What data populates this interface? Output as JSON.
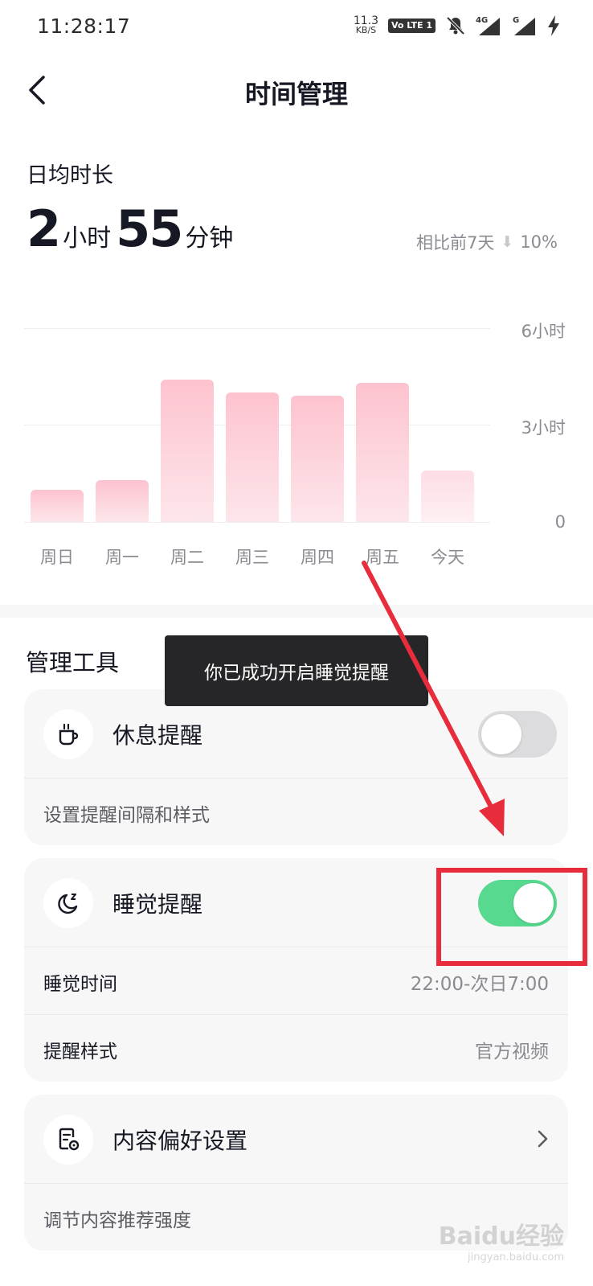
{
  "status_bar": {
    "time": "11:28:17",
    "net_speed_value": "11.3",
    "net_speed_unit": "KB/S",
    "volte": "Vo LTE 1",
    "signal_4g": "4G",
    "signal_g": "G"
  },
  "nav": {
    "title": "时间管理"
  },
  "summary": {
    "label": "日均时长",
    "hours": "2",
    "hours_unit": "小时",
    "minutes": "55",
    "minutes_unit": "分钟",
    "compare_text": "相比前7天",
    "compare_change": "10%"
  },
  "chart_data": {
    "type": "bar",
    "categories": [
      "周日",
      "周一",
      "周二",
      "周三",
      "周四",
      "周五",
      "今天"
    ],
    "values": [
      1.0,
      1.3,
      4.4,
      4.0,
      3.9,
      4.3,
      1.6
    ],
    "y_ticks": [
      "6小时",
      "3小时",
      "0"
    ],
    "ylim": [
      0,
      6
    ],
    "grid": true,
    "color": "#fdc3cf"
  },
  "tools": {
    "section_title": "管理工具",
    "rest": {
      "title": "休息提醒",
      "subtitle": "设置提醒间隔和样式",
      "enabled": false
    },
    "sleep": {
      "title": "睡觉提醒",
      "enabled": true,
      "time_label": "睡觉时间",
      "time_value": "22:00-次日7:00",
      "style_label": "提醒样式",
      "style_value": "官方视频"
    },
    "content": {
      "title": "内容偏好设置",
      "subtitle": "调节内容推荐强度"
    }
  },
  "toast": {
    "text": "你已成功开启睡觉提醒"
  },
  "colors": {
    "toggle_on": "#57d98f",
    "toggle_off": "#dcdcde",
    "annotation": "#e72d3b"
  },
  "watermark": {
    "brand": "Baidu经验",
    "domain": "jingyan.baidu.com"
  }
}
